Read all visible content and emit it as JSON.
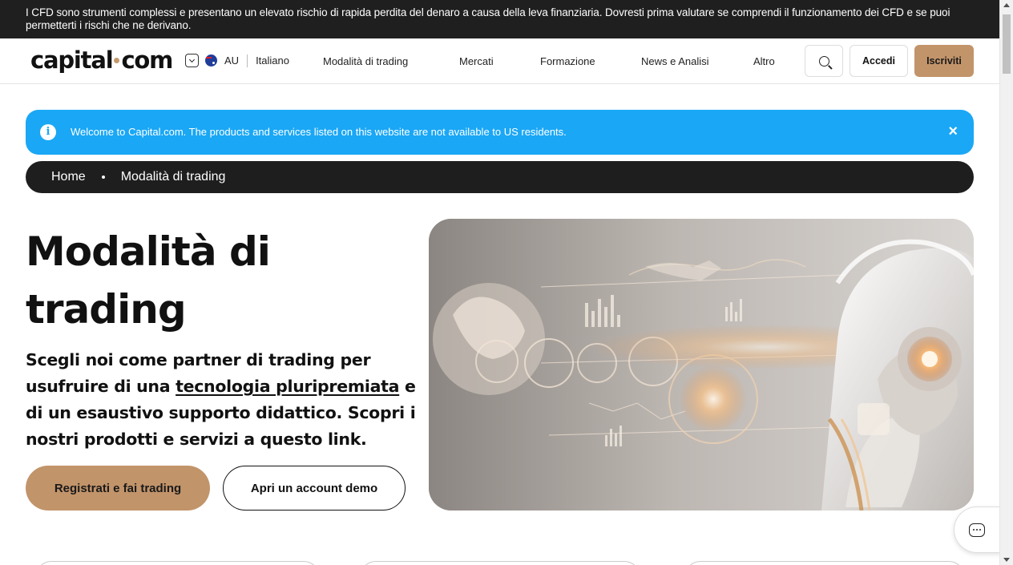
{
  "risk_warning": "I CFD sono strumenti complessi e presentano un elevato rischio di rapida perdita del denaro a causa della leva finanziaria. Dovresti prima valutare se comprendi il funzionamento dei CFD e se puoi permetterti i rischi che ne derivano.",
  "header": {
    "logo_left": "capital",
    "logo_right": "com",
    "region_code": "AU",
    "language": "Italiano",
    "menu": [
      "Modalità di trading",
      "Mercati",
      "Formazione",
      "News e Analisi",
      "Altro"
    ],
    "login_label": "Accedi",
    "signup_label": "Iscriviti"
  },
  "info_banner": {
    "message": "Welcome to Capital.com. The products and services listed on this website are not available to US residents.",
    "icon": "i",
    "close": "×"
  },
  "breadcrumb": [
    "Home",
    "Modalità di trading"
  ],
  "hero": {
    "title": "Modalità di trading",
    "desc_before": "Scegli noi come partner di trading per usufruire di una ",
    "desc_link": "tecnologia pluripremiata",
    "desc_after": " e di un esaustivo supporto didattico. Scopri i nostri prodotti e servizi a questo link.",
    "primary_cta": "Registrati e fai trading",
    "secondary_cta": "Apri un account demo"
  },
  "colors": {
    "accent": "#c2946a",
    "banner": "#1aa7f5",
    "dark": "#1f1e1e"
  }
}
